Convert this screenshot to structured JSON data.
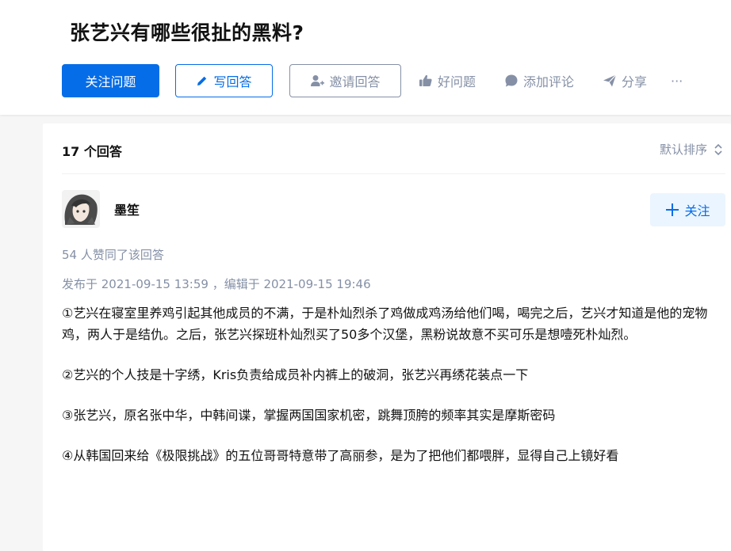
{
  "question": {
    "title": "张艺兴有哪些很扯的黑料?"
  },
  "toolbar": {
    "follow_label": "关注问题",
    "write_label": "写回答",
    "invite_label": "邀请回答",
    "good_question_label": "好问题",
    "comment_label": "添加评论",
    "share_label": "分享",
    "more_label": "···"
  },
  "colors": {
    "primary": "#056de8",
    "muted": "#8590a6",
    "text": "#121212",
    "follow_bg": "#ebf5ff"
  },
  "icons": {
    "write": "pencil-icon",
    "invite": "add-user-icon",
    "good_question": "thumbs-up-icon",
    "comment": "comment-bubble-icon",
    "share": "paper-plane-icon",
    "sort": "chevron-updown-icon",
    "follow": "plus-icon"
  },
  "answers": {
    "count_label": "17 个回答",
    "sort_label": "默认排序"
  },
  "answer": {
    "author_name": "墨笙",
    "follow_label": "关注",
    "votes_text": "54 人赞同了该回答",
    "dates_text": "发布于 2021-09-15 13:59 ，编辑于 2021-09-15 19:46",
    "paragraphs": [
      "①艺兴在寝室里养鸡引起其他成员的不满，于是朴灿烈杀了鸡做成鸡汤给他们喝，喝完之后，艺兴才知道是他的宠物鸡，两人于是结仇。之后，张艺兴探班朴灿烈买了50多个汉堡，黑粉说故意不买可乐是想噎死朴灿烈。",
      "②艺兴的个人技是十字绣，Kris负责给成员补内裤上的破洞，张艺兴再绣花装点一下",
      "③张艺兴，原名张中华，中韩间谍，掌握两国国家机密，跳舞顶胯的频率其实是摩斯密码",
      "④从韩国回来给《极限挑战》的五位哥哥特意带了高丽参，是为了把他们都喂胖，显得自己上镜好看"
    ]
  }
}
